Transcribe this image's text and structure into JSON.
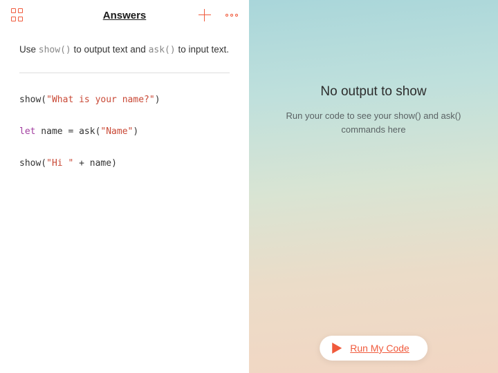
{
  "header": {
    "title": "Answers"
  },
  "instruction": {
    "prefix": "Use ",
    "code1": "show()",
    "middle": " to output text and ",
    "code2": "ask()",
    "suffix": " to input text."
  },
  "code": {
    "line1_a": "show(",
    "line1_str": "\"What is your name?\"",
    "line1_b": ")",
    "line2_kw": "let",
    "line2_rest": " name = ask(",
    "line2_str": "\"Name\"",
    "line2_b": ")",
    "line3_a": "show(",
    "line3_str": "\"Hi \"",
    "line3_b": " + name)"
  },
  "output": {
    "title": "No output to show",
    "subtitle": "Run your code to see your show() and ask() commands here"
  },
  "run_button": {
    "label": "Run My Code"
  }
}
